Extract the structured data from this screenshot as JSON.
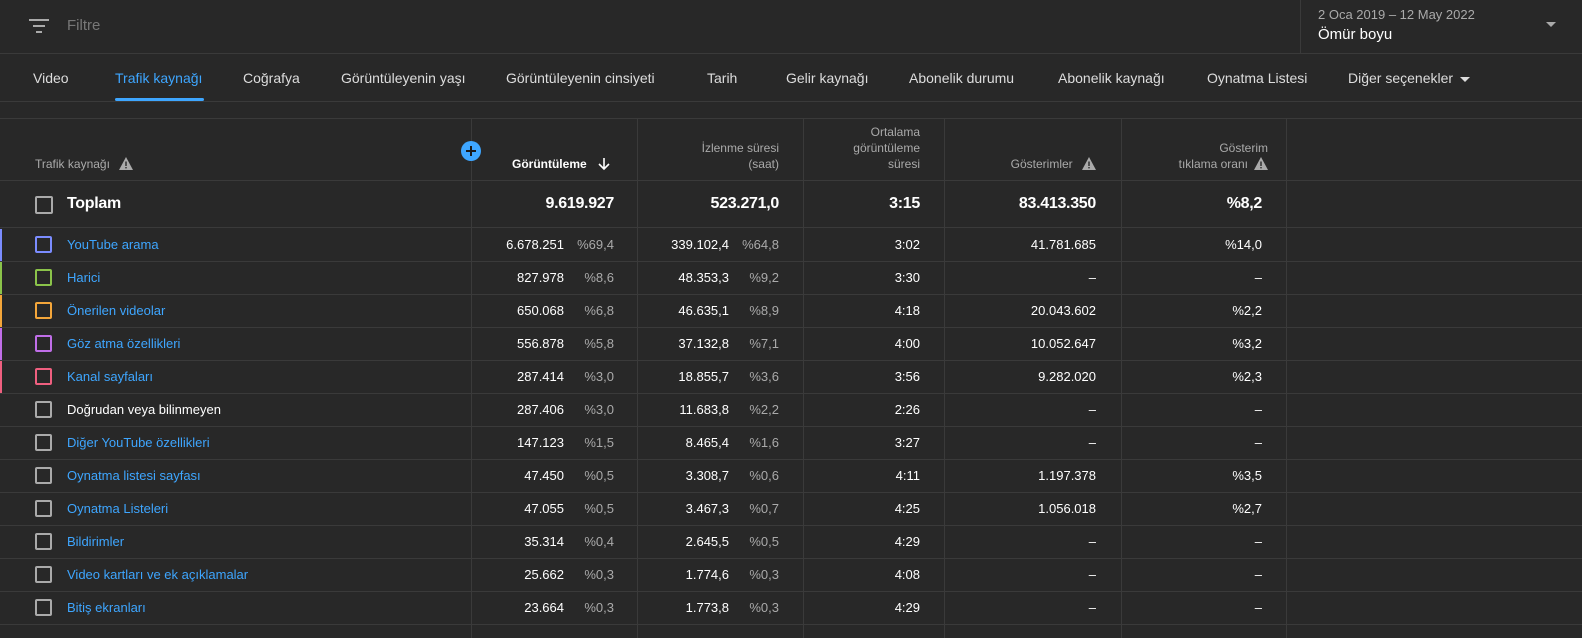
{
  "filter": {
    "placeholder": "Filtre"
  },
  "date": {
    "range": "2 Oca 2019 – 12 May 2022",
    "label": "Ömür boyu"
  },
  "tabs": [
    {
      "label": "Video"
    },
    {
      "label": "Trafik kaynağı",
      "active": true
    },
    {
      "label": "Coğrafya"
    },
    {
      "label": "Görüntüleyenin yaşı"
    },
    {
      "label": "Görüntüleyenin cinsiyeti"
    },
    {
      "label": "Tarih"
    },
    {
      "label": "Gelir kaynağı"
    },
    {
      "label": "Abonelik durumu"
    },
    {
      "label": "Abonelik kaynağı"
    },
    {
      "label": "Oynatma Listesi"
    },
    {
      "label": "Diğer seçenekler"
    }
  ],
  "table": {
    "headers": {
      "source": "Trafik kaynağı",
      "views": "Görüntüleme",
      "watch_time_1": "İzlenme süresi",
      "watch_time_2": "(saat)",
      "avg_1": "Ortalama",
      "avg_2": "görüntüleme",
      "avg_3": "süresi",
      "impressions": "Gösterimler",
      "ctr_1": "Gösterim",
      "ctr_2": "tıklama oranı"
    },
    "total": {
      "name": "Toplam",
      "views": "9.619.927",
      "watch": "523.271,0",
      "avg": "3:15",
      "impressions": "83.413.350",
      "ctr": "%8,2"
    },
    "rows": [
      {
        "name": "YouTube arama",
        "link": true,
        "color": "#7b8cff",
        "views": "6.678.251",
        "views_pct": "%69,4",
        "watch": "339.102,4",
        "watch_pct": "%64,8",
        "avg": "3:02",
        "impressions": "41.781.685",
        "ctr": "%14,0"
      },
      {
        "name": "Harici",
        "link": true,
        "color": "#8bc34a",
        "views": "827.978",
        "views_pct": "%8,6",
        "watch": "48.353,3",
        "watch_pct": "%9,2",
        "avg": "3:30",
        "impressions": "–",
        "ctr": "–"
      },
      {
        "name": "Önerilen videolar",
        "link": true,
        "color": "#f4a63a",
        "views": "650.068",
        "views_pct": "%6,8",
        "watch": "46.635,1",
        "watch_pct": "%8,9",
        "avg": "4:18",
        "impressions": "20.043.602",
        "ctr": "%2,2"
      },
      {
        "name": "Göz atma özellikleri",
        "link": true,
        "color": "#c06ee8",
        "views": "556.878",
        "views_pct": "%5,8",
        "watch": "37.132,8",
        "watch_pct": "%7,1",
        "avg": "4:00",
        "impressions": "10.052.647",
        "ctr": "%3,2"
      },
      {
        "name": "Kanal sayfaları",
        "link": true,
        "color": "#ef5f7f",
        "views": "287.414",
        "views_pct": "%3,0",
        "watch": "18.855,7",
        "watch_pct": "%3,6",
        "avg": "3:56",
        "impressions": "9.282.020",
        "ctr": "%2,3"
      },
      {
        "name": "Doğrudan veya bilinmeyen",
        "link": false,
        "color": "",
        "views": "287.406",
        "views_pct": "%3,0",
        "watch": "11.683,8",
        "watch_pct": "%2,2",
        "avg": "2:26",
        "impressions": "–",
        "ctr": "–"
      },
      {
        "name": "Diğer YouTube özellikleri",
        "link": true,
        "color": "",
        "views": "147.123",
        "views_pct": "%1,5",
        "watch": "8.465,4",
        "watch_pct": "%1,6",
        "avg": "3:27",
        "impressions": "–",
        "ctr": "–"
      },
      {
        "name": "Oynatma listesi sayfası",
        "link": true,
        "color": "",
        "views": "47.450",
        "views_pct": "%0,5",
        "watch": "3.308,7",
        "watch_pct": "%0,6",
        "avg": "4:11",
        "impressions": "1.197.378",
        "ctr": "%3,5"
      },
      {
        "name": "Oynatma Listeleri",
        "link": true,
        "color": "",
        "views": "47.055",
        "views_pct": "%0,5",
        "watch": "3.467,3",
        "watch_pct": "%0,7",
        "avg": "4:25",
        "impressions": "1.056.018",
        "ctr": "%2,7"
      },
      {
        "name": "Bildirimler",
        "link": true,
        "color": "",
        "views": "35.314",
        "views_pct": "%0,4",
        "watch": "2.645,5",
        "watch_pct": "%0,5",
        "avg": "4:29",
        "impressions": "–",
        "ctr": "–"
      },
      {
        "name": "Video kartları ve ek açıklamalar",
        "link": true,
        "color": "",
        "views": "25.662",
        "views_pct": "%0,3",
        "watch": "1.774,6",
        "watch_pct": "%0,3",
        "avg": "4:08",
        "impressions": "–",
        "ctr": "–"
      },
      {
        "name": "Bitiş ekranları",
        "link": true,
        "color": "",
        "views": "23.664",
        "views_pct": "%0,3",
        "watch": "1.773,8",
        "watch_pct": "%0,3",
        "avg": "4:29",
        "impressions": "–",
        "ctr": "–"
      }
    ]
  }
}
